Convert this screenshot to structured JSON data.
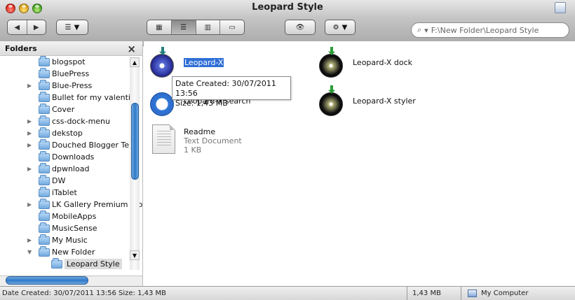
{
  "window": {
    "title": "Leopard Style",
    "buttons": {
      "back": "◀",
      "forward": "▶",
      "icon_view": "▦",
      "list_view": "☰",
      "column_view": "▥",
      "coverflow_view": "▭",
      "quick_look": "👁",
      "action": "⚙"
    },
    "search": {
      "value": "F:\\New Folder\\Leopard Style",
      "placeholder": "F:\\New Folder\\Leopard Style"
    }
  },
  "sidebar": {
    "title": "Folders",
    "close_label": "×",
    "items": [
      {
        "label": "blogspot",
        "arrow": ""
      },
      {
        "label": "BluePress",
        "arrow": ""
      },
      {
        "label": "Blue-Press",
        "arrow": "▶"
      },
      {
        "label": "Bullet for my valentine",
        "arrow": ""
      },
      {
        "label": "Cover",
        "arrow": ""
      },
      {
        "label": "css-dock-menu",
        "arrow": "▶"
      },
      {
        "label": "dekstop",
        "arrow": "▶"
      },
      {
        "label": "Douched Blogger Tem",
        "arrow": "▶"
      },
      {
        "label": "Downloads",
        "arrow": ""
      },
      {
        "label": "dpwnload",
        "arrow": "▶"
      },
      {
        "label": "DW",
        "arrow": ""
      },
      {
        "label": "iTablet",
        "arrow": ""
      },
      {
        "label": "LK Gallery Premium Blo",
        "arrow": "▶"
      },
      {
        "label": "MobileApps",
        "arrow": ""
      },
      {
        "label": "MusicSense",
        "arrow": ""
      },
      {
        "label": "My Music",
        "arrow": "▶"
      },
      {
        "label": "New Folder",
        "arrow": "▼"
      },
      {
        "label": "Leopard Style",
        "arrow": ""
      }
    ]
  },
  "content": {
    "items": [
      {
        "name": "Leopard-X",
        "type": "selected"
      },
      {
        "name": "Leopard-X dock",
        "type": "app"
      },
      {
        "name": "Leopard-X search",
        "type": "app"
      },
      {
        "name": "Leopard-X styler",
        "type": "app"
      },
      {
        "name": "Readme",
        "meta1": "Text Document",
        "meta2": "1 KB",
        "type": "document"
      }
    ],
    "tooltip": {
      "line1": "Date Created: 30/07/2011 13:56",
      "line2": "Size: 1,43 MB"
    }
  },
  "statusbar": {
    "left": "Date Created: 30/07/2011 13:56 Size: 1,43 MB",
    "size": "1,43 MB",
    "location": "My Computer"
  }
}
